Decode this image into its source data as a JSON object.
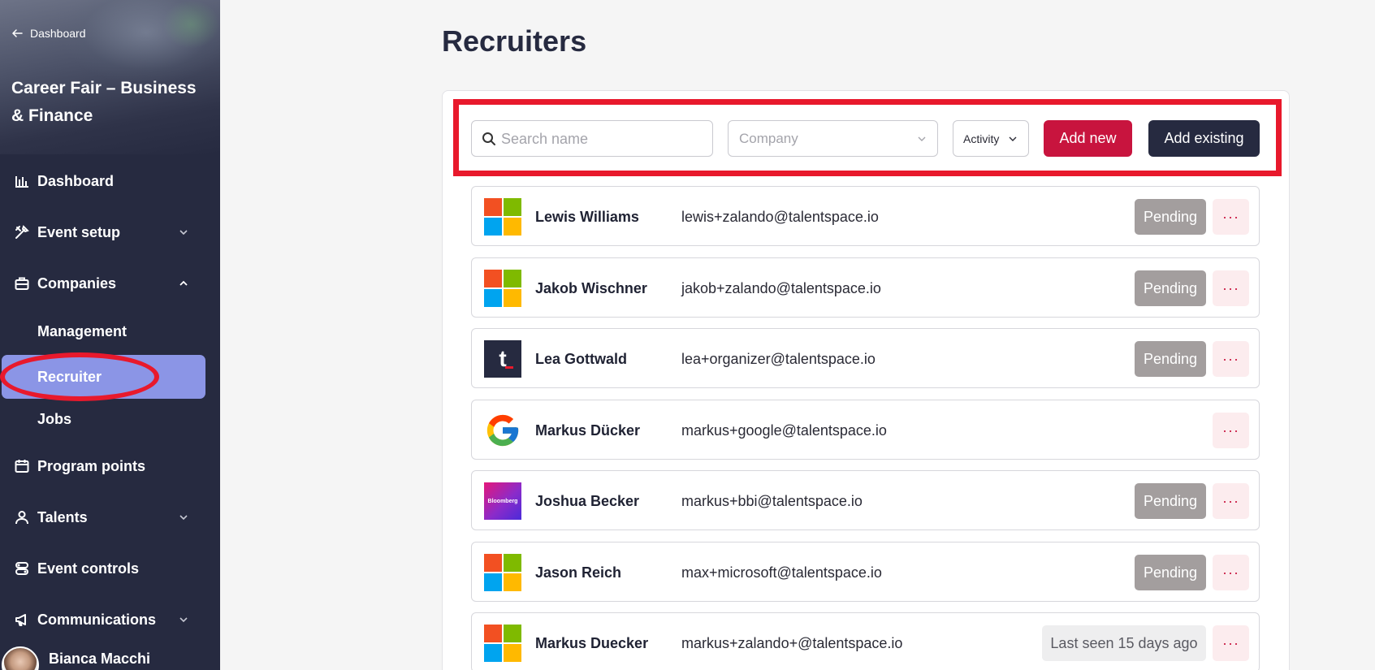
{
  "sidebar": {
    "back_label": "Dashboard",
    "event_title": "Career Fair – Business & Finance",
    "nav": {
      "dashboard": "Dashboard",
      "event_setup": "Event setup",
      "companies": "Companies",
      "management": "Management",
      "recruiter": "Recruiter",
      "jobs": "Jobs",
      "program_points": "Program points",
      "talents": "Talents",
      "event_controls": "Event controls",
      "communications": "Communications"
    },
    "user_name": "Bianca Macchi"
  },
  "main": {
    "title": "Recruiters",
    "toolbar": {
      "search_placeholder": "Search name",
      "company_placeholder": "Company",
      "activity_label": "Activity",
      "add_new": "Add new",
      "add_existing": "Add existing"
    },
    "more_label": "···",
    "rows": [
      {
        "name": "Lewis Williams",
        "email": "lewis+zalando@talentspace.io",
        "logo": "microsoft-logo",
        "status": "Pending"
      },
      {
        "name": "Jakob Wischner",
        "email": "jakob+zalando@talentspace.io",
        "logo": "microsoft-logo",
        "status": "Pending"
      },
      {
        "name": "Lea Gottwald",
        "email": "lea+organizer@talentspace.io",
        "logo": "talentspace-logo",
        "logo_text": "t",
        "status": "Pending"
      },
      {
        "name": "Markus Dücker",
        "email": "markus+google@talentspace.io",
        "logo": "google-logo",
        "status": ""
      },
      {
        "name": "Joshua Becker",
        "email": "markus+bbi@talentspace.io",
        "logo": "bloomberg-logo",
        "logo_text": "Bloomberg",
        "status": "Pending"
      },
      {
        "name": "Jason Reich",
        "email": "max+microsoft@talentspace.io",
        "logo": "microsoft-logo",
        "status": "Pending"
      },
      {
        "name": "Markus Duecker",
        "email": "markus+zalando+@talentspace.io",
        "logo": "microsoft-logo",
        "last_seen": "Last seen 15 days ago"
      }
    ]
  },
  "colors": {
    "sidebar_bg": "#262a40",
    "active_item": "#8b95e6",
    "primary_red": "#c8143e",
    "dark_button": "#262a40",
    "pending_badge": "#a39e9e",
    "highlight": "#e8192c"
  }
}
